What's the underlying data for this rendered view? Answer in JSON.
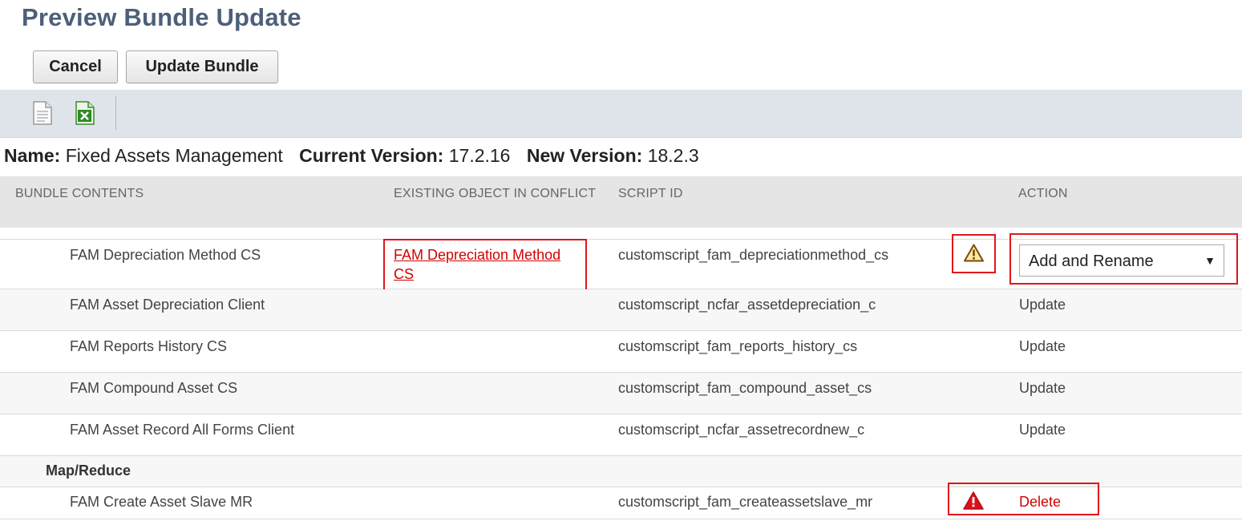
{
  "page": {
    "title": "Preview Bundle Update"
  },
  "buttons": {
    "cancel": "Cancel",
    "update": "Update Bundle"
  },
  "toolbar": {
    "icons": [
      "document-icon",
      "excel-export-icon"
    ]
  },
  "info": {
    "name_label": "Name:",
    "name_value": "Fixed Assets Management",
    "current_label": "Current Version:",
    "current_value": "17.2.16",
    "new_label": "New Version:",
    "new_value": "18.2.3"
  },
  "table": {
    "headers": [
      "BUNDLE CONTENTS",
      "EXISTING OBJECT IN CONFLICT",
      "SCRIPT ID",
      "ACTION"
    ],
    "rows": [
      {
        "name": "FAM Depreciation Method CS",
        "conflict": "FAM Depreciation Method CS",
        "script_id": "customscript_fam_depreciationmethod_cs",
        "action": "Add and Rename",
        "warning": "caution"
      },
      {
        "name": "FAM Asset Depreciation Client",
        "conflict": "",
        "script_id": "customscript_ncfar_assetdepreciation_c",
        "action": "Update"
      },
      {
        "name": "FAM Reports History CS",
        "conflict": "",
        "script_id": "customscript_fam_reports_history_cs",
        "action": "Update"
      },
      {
        "name": "FAM Compound Asset CS",
        "conflict": "",
        "script_id": "customscript_fam_compound_asset_cs",
        "action": "Update"
      },
      {
        "name": "FAM Asset Record All Forms Client",
        "conflict": "",
        "script_id": "customscript_ncfar_assetrecordnew_c",
        "action": "Update"
      }
    ],
    "group": "Map/Reduce",
    "group_rows": [
      {
        "name": "FAM Create Asset Slave MR",
        "conflict": "",
        "script_id": "customscript_fam_createassetslave_mr",
        "action": "Delete",
        "warning": "error"
      }
    ]
  },
  "colors": {
    "title": "#4d5f79",
    "toolbar_bg": "#dfe4eb",
    "highlight_border": "#e0151b",
    "link": "#d40000"
  }
}
